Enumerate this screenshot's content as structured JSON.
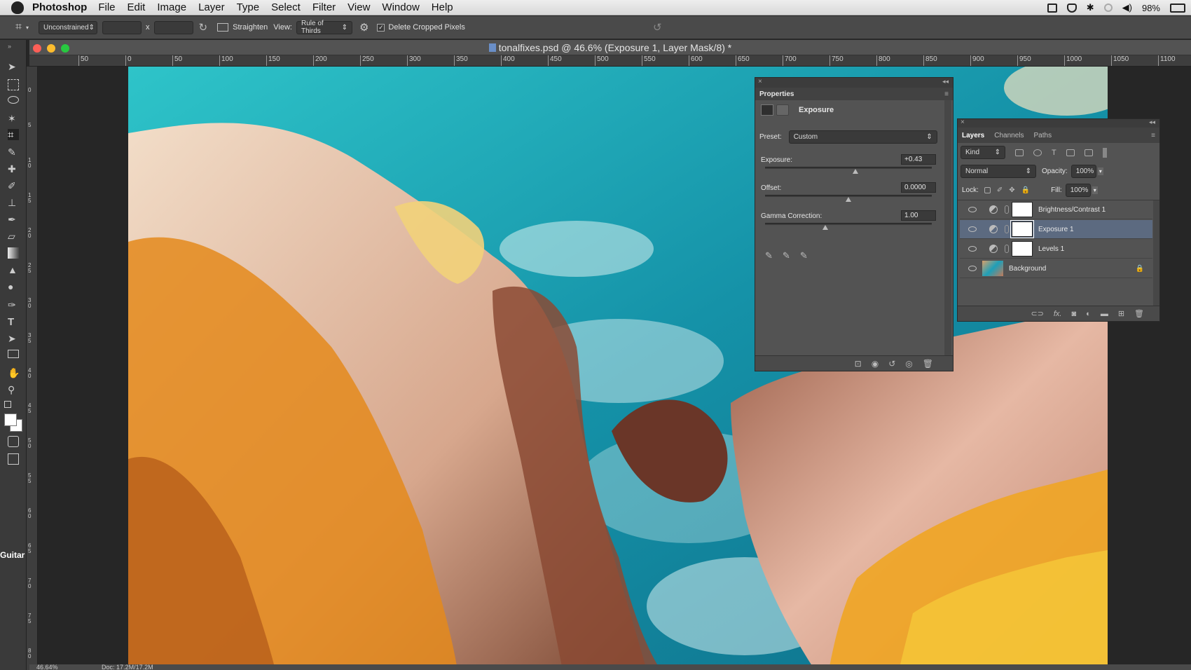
{
  "menubar": {
    "app_name": "Photoshop",
    "items": [
      "File",
      "Edit",
      "Image",
      "Layer",
      "Type",
      "Select",
      "Filter",
      "View",
      "Window",
      "Help"
    ],
    "battery": "98%"
  },
  "options_bar": {
    "ratio": "Unconstrained",
    "x_label": "x",
    "straighten": "Straighten",
    "view_label": "View:",
    "view_value": "Rule of Thirds",
    "delete_cropped": "Delete Cropped Pixels"
  },
  "document": {
    "title": "tonalfixes.psd @ 46.6% (Exposure 1, Layer Mask/8) *",
    "ruler_h": [
      "50",
      "0",
      "50",
      "100",
      "150",
      "200",
      "250",
      "300",
      "350",
      "400",
      "450",
      "500",
      "550",
      "600",
      "650",
      "700",
      "750",
      "800",
      "850",
      "900",
      "950",
      "1000",
      "1050",
      "1100"
    ],
    "ruler_v": [
      "0",
      "5",
      "1 0",
      "1 5",
      "2 0",
      "2 5",
      "3 0",
      "3 5",
      "4 0",
      "4 5",
      "5 0",
      "5 5",
      "6 0",
      "6 5",
      "7 0",
      "7 5",
      "8 0",
      "8 5"
    ],
    "zoom_status": "46.64%",
    "doc_status": "Doc: 17.2M/17.2M",
    "side_label": "Guitar"
  },
  "properties": {
    "title": "Properties",
    "adjustment_name": "Exposure",
    "preset_label": "Preset:",
    "preset_value": "Custom",
    "exposure_label": "Exposure:",
    "exposure_value": "+0.43",
    "exposure_level": 0.54,
    "offset_label": "Offset:",
    "offset_value": "0.0000",
    "offset_level": 0.5,
    "gamma_label": "Gamma Correction:",
    "gamma_value": "1.00",
    "gamma_level": 0.36
  },
  "layers": {
    "tabs": [
      "Layers",
      "Channels",
      "Paths"
    ],
    "kind": "Kind",
    "blend_mode": "Normal",
    "opacity_label": "Opacity:",
    "opacity_value": "100%",
    "lock_label": "Lock:",
    "fill_label": "Fill:",
    "fill_value": "100%",
    "items": [
      {
        "name": "Brightness/Contrast 1"
      },
      {
        "name": "Exposure 1"
      },
      {
        "name": "Levels 1"
      },
      {
        "name": "Background"
      }
    ],
    "selected_color": "#5c6a80"
  }
}
